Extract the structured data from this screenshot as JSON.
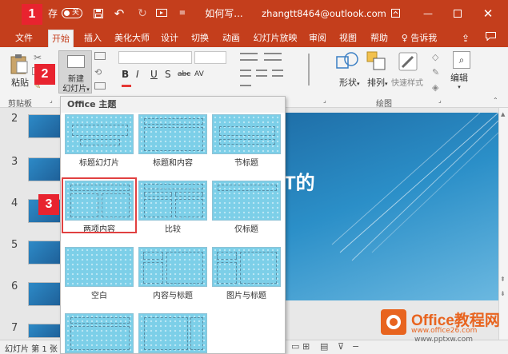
{
  "titlebar": {
    "autosave": "存",
    "toggle": "关",
    "doc_title": "如何写...",
    "account": "zhangtt8464@outlook.com"
  },
  "tabs": [
    "文件",
    "开始",
    "插入",
    "美化大师",
    "设计",
    "切换",
    "动画",
    "幻灯片放映",
    "审阅",
    "视图",
    "帮助",
    "告诉我"
  ],
  "ribbon": {
    "paste": "粘贴",
    "new_slide": "新建\n幻灯片",
    "new_slide_line1": "新建",
    "new_slide_line2": "幻灯片",
    "clipboard_group": "剪贴板",
    "shapes": "形状",
    "arrange": "排列",
    "quick_styles": "快速样式",
    "drawing_group": "绘图",
    "editing": "编辑",
    "font_B": "B",
    "font_I": "I",
    "font_U": "U",
    "font_S": "S",
    "font_abc": "abc",
    "font_AV": "AV"
  },
  "steps": [
    "1",
    "2",
    "3"
  ],
  "thumbs": [
    "2",
    "3",
    "4",
    "5",
    "6",
    "7"
  ],
  "gallery": {
    "header": "Office 主题",
    "layouts": [
      "标题幻灯片",
      "标题和内容",
      "节标题",
      "两项内容",
      "比较",
      "仅标题",
      "空白",
      "内容与标题",
      "图片与标题"
    ],
    "selected": "两项内容"
  },
  "slide": {
    "visible_text": "T的"
  },
  "status": {
    "text": "幻灯片 第 1 张"
  },
  "watermark": {
    "brand": "Office教程网",
    "url": "www.office26.com",
    "site": "www.pptxw.com"
  }
}
